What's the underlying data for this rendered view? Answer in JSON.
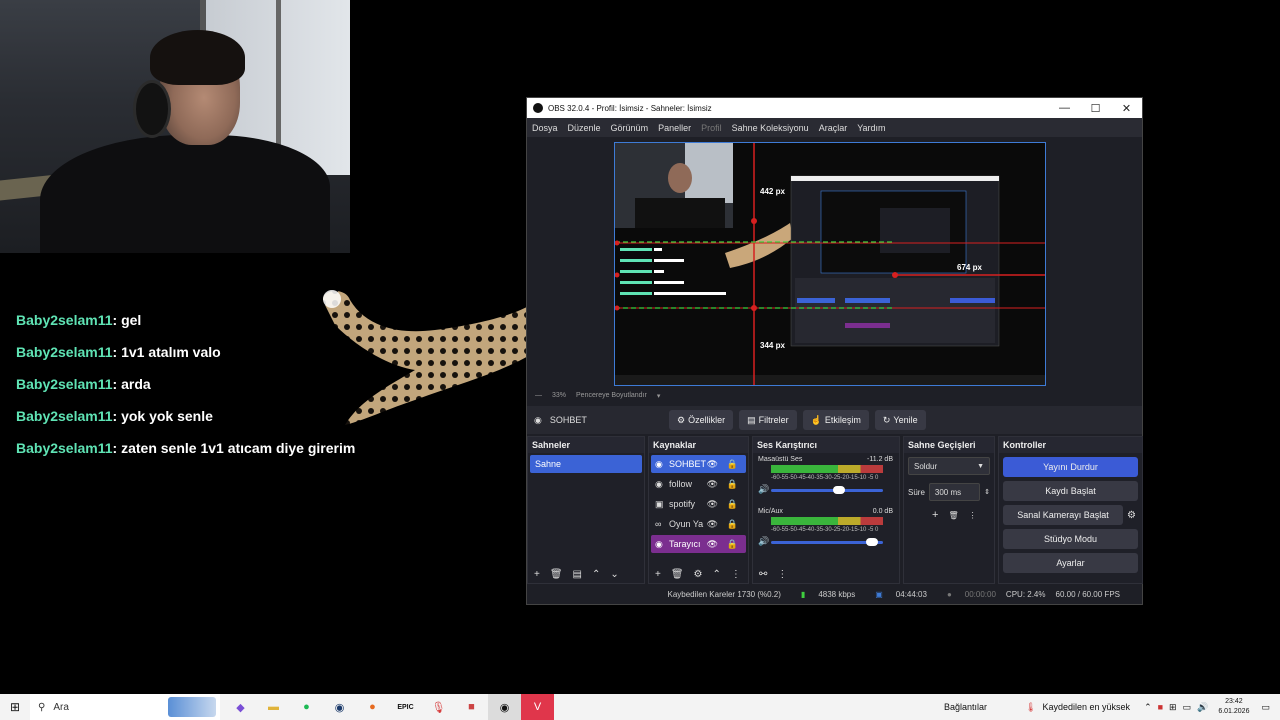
{
  "chat": {
    "messages": [
      {
        "user": "Baby2selam11",
        "text": ": gel"
      },
      {
        "user": "Baby2selam11",
        "text": ": 1v1 atalım valo"
      },
      {
        "user": "Baby2selam11",
        "text": ": arda"
      },
      {
        "user": "Baby2selam11",
        "text": ": yok yok senle"
      },
      {
        "user": "Baby2selam11",
        "text": ": zaten senle 1v1 atıcam diye girerim"
      }
    ]
  },
  "obs": {
    "title": "OBS 32.0.4 - Profil: İsimsiz - Sahneler: İsimsiz",
    "window_buttons": [
      "—",
      "☐",
      "✕"
    ],
    "menu": [
      "Dosya",
      "Düzenle",
      "Görünüm",
      "Paneller",
      "Profil",
      "Sahne Koleksiyonu",
      "Araçlar",
      "Yardım"
    ],
    "preview": {
      "top_px": "442 px",
      "right_px": "674 px",
      "bottom_px": "344 px",
      "zoom": "33%",
      "fit": "Pencereye Boyutlandır"
    },
    "source_toolbar": {
      "name": "SOHBET",
      "properties": "Özellikler",
      "filters": "Filtreler",
      "interact": "Etkileşim",
      "refresh": "Yenile"
    },
    "docks": {
      "scenes": {
        "title": "Sahneler",
        "items": [
          "Sahne"
        ]
      },
      "sources": {
        "title": "Kaynaklar",
        "items": [
          {
            "label": "SOHBET",
            "icon": "browser-icon"
          },
          {
            "label": "follow",
            "icon": "browser-icon"
          },
          {
            "label": "spotify",
            "icon": "window-capture-icon"
          },
          {
            "label": "Oyun Ya",
            "icon": "game-capture-icon"
          },
          {
            "label": "Tarayıcı",
            "icon": "browser-icon"
          }
        ]
      },
      "mixer": {
        "title": "Ses Karıştırıcı",
        "channels": [
          {
            "name": "Masaüstü Ses",
            "db": "-11.2 dB",
            "volume": 0.62
          },
          {
            "name": "Mic/Aux",
            "db": "0.0 dB",
            "volume": 0.95
          }
        ],
        "scale": "-60-55-50-45-40-35-30-25-20-15-10 -5  0"
      },
      "transitions": {
        "title": "Sahne Geçişleri",
        "type": "Soldur",
        "duration_label": "Süre",
        "duration": "300 ms"
      },
      "controls": {
        "title": "Kontroller",
        "buttons": [
          "Yayını Durdur",
          "Kaydı Başlat",
          "Sanal Kamerayı Başlat",
          "Stüdyo Modu",
          "Ayarlar"
        ]
      }
    },
    "status": {
      "dropped": "Kaybedilen Kareler 1730 (%0.2)",
      "bitrate": "4838 kbps",
      "stream_time": "04:44:03",
      "rec_time": "00:00:00",
      "cpu": "CPU: 2.4%",
      "fps": "60.00 / 60.00 FPS"
    }
  },
  "taskbar": {
    "search": "Ara",
    "connections": "Bağlantılar",
    "weather": "Kaydedilen en yüksek",
    "time": "23:42",
    "date": "6.01.2026"
  }
}
